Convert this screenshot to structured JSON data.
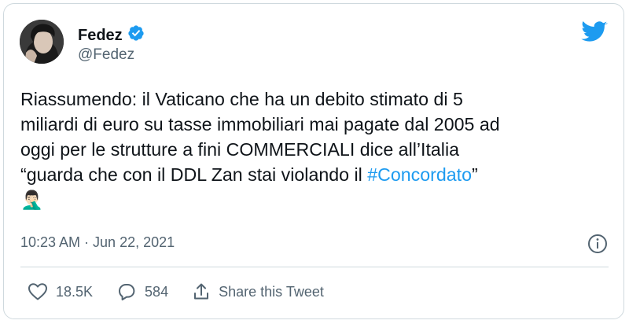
{
  "author": {
    "display_name": "Fedez",
    "handle": "@Fedez",
    "verified": true
  },
  "tweet": {
    "text_before_hashtag": "Riassumendo: il Vaticano che ha un debito stimato di 5\nmiliardi di euro su tasse immobiliari mai pagate dal 2005 ad\noggi per le strutture a fini COMMERCIALI dice all’Italia\n“guarda che con il DDL Zan stai violando il ",
    "hashtag": "#Concordato",
    "text_after_hashtag": "”",
    "emoji": "🤦🏻‍♂️",
    "timestamp": "10:23 AM · Jun 22, 2021"
  },
  "actions": {
    "likes": "18.5K",
    "replies": "584",
    "share_label": "Share this Tweet"
  },
  "icons": {
    "logo": "twitter-bird-icon",
    "verified": "verified-badge-icon",
    "info": "info-icon",
    "like": "heart-icon",
    "reply": "reply-bubble-icon",
    "share": "share-icon"
  },
  "colors": {
    "accent": "#1d9bf0",
    "text": "#0f1419",
    "secondary": "#536471",
    "border": "#cfd9de"
  }
}
